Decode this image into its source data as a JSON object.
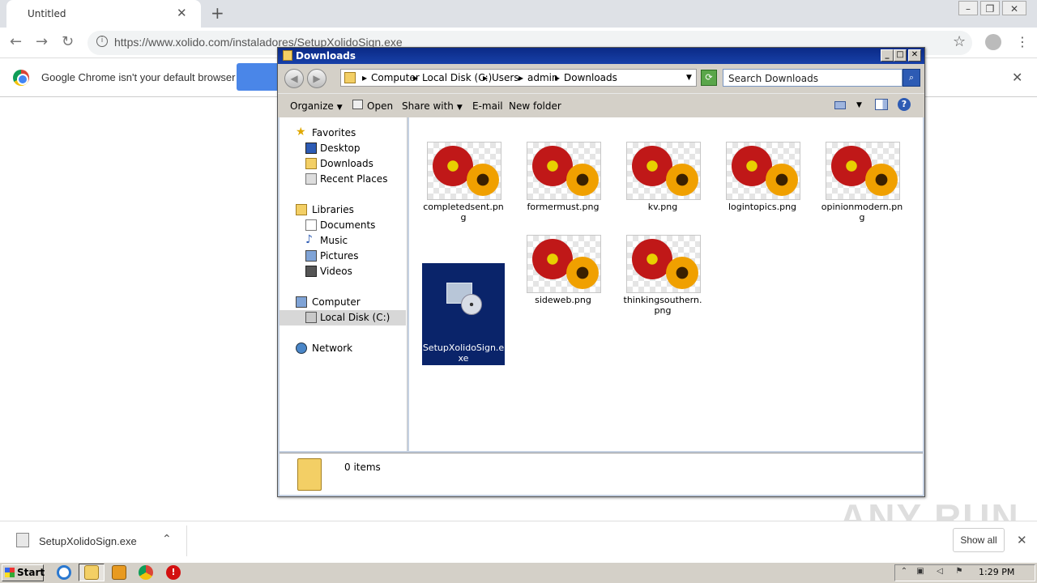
{
  "browser": {
    "tab_title": "Untitled",
    "tab_close": "✕",
    "new_tab": "+",
    "url": "https://www.xolido.com/instaladores/SetupXolidoSign.exe",
    "infobar_text": "Google Chrome isn't your default browser",
    "infobar_close": "✕"
  },
  "explorer": {
    "title": "Downloads",
    "breadcrumb": [
      "Computer",
      "Local Disk (C:)",
      "Users",
      "admin",
      "Downloads"
    ],
    "search_placeholder": "Search Downloads",
    "commands": {
      "organize": "Organize",
      "open": "Open",
      "share_with": "Share with",
      "email": "E-mail",
      "new_folder": "New folder"
    },
    "nav": {
      "favorites": "Favorites",
      "desktop": "Desktop",
      "downloads": "Downloads",
      "recent": "Recent Places",
      "libraries": "Libraries",
      "documents": "Documents",
      "music": "Music",
      "pictures": "Pictures",
      "videos": "Videos",
      "computer": "Computer",
      "local_disk": "Local Disk (C:)",
      "network": "Network"
    },
    "files": [
      "completedsent.png",
      "formermust.png",
      "kv.png",
      "logintopics.png",
      "opinionmodern.png",
      "SetupXolidoSign.exe",
      "sideweb.png",
      "thinkingsouthern.png"
    ],
    "status": "0 items"
  },
  "downloads_bar": {
    "file": "SetupXolidoSign.exe",
    "show_all": "Show all",
    "close": "✕"
  },
  "watermark": "ANY RUN",
  "taskbar": {
    "start": "Start",
    "clock": "1:29 PM"
  }
}
